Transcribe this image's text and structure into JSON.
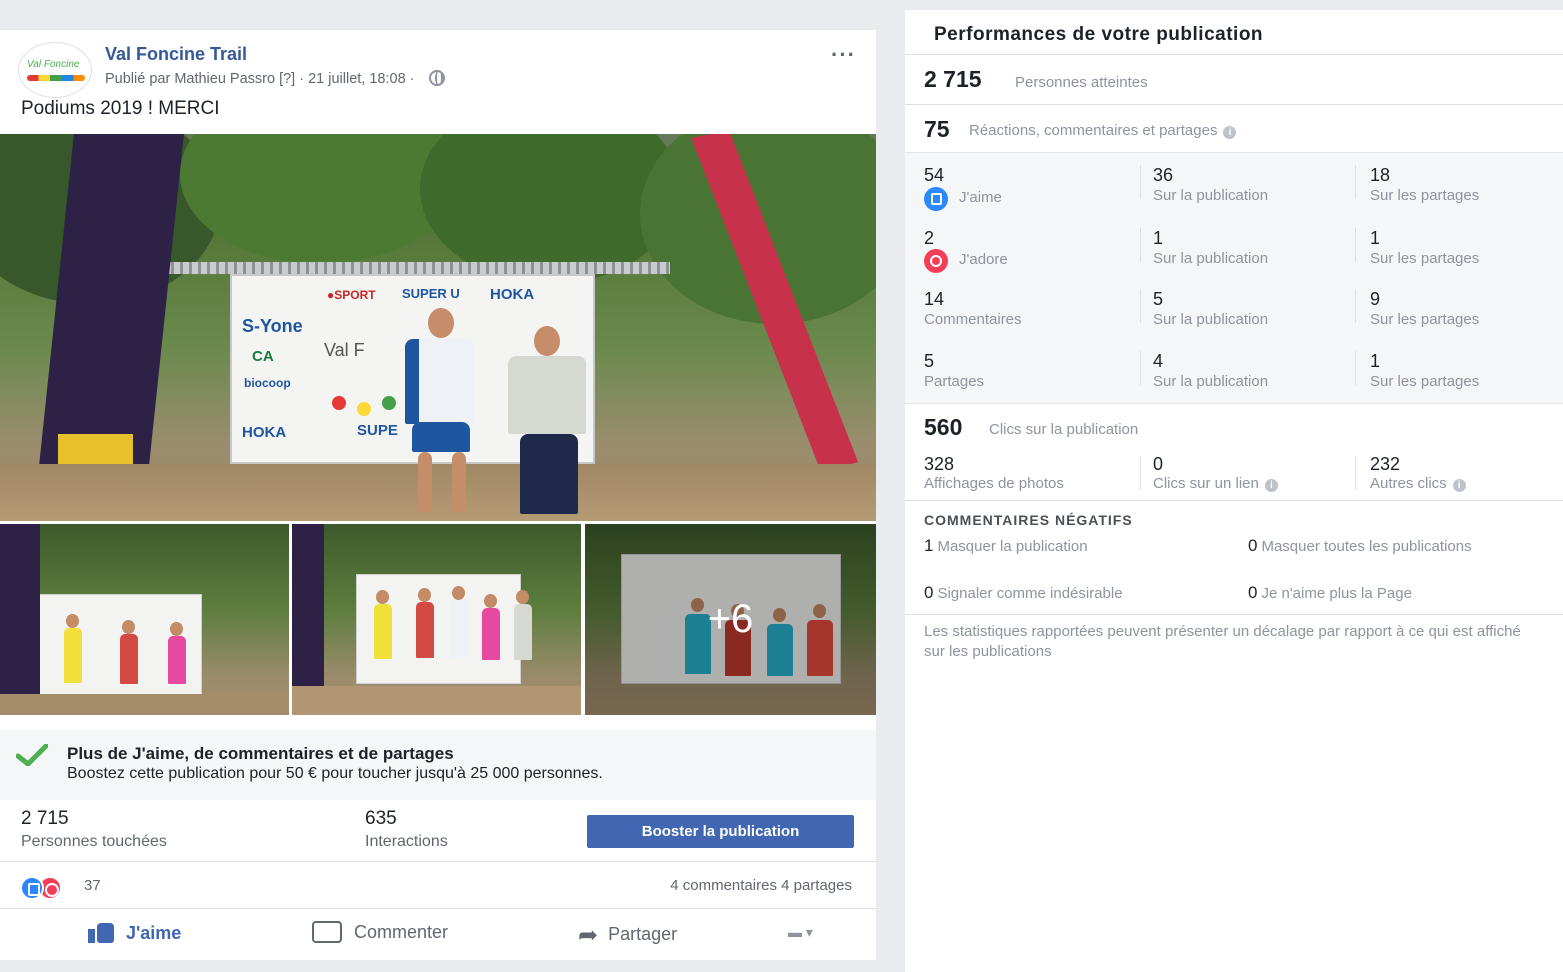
{
  "post": {
    "page_name": "Val Foncine Trail",
    "meta": "Publié par Mathieu Passro [?] · 21 juillet, 18:08 ·",
    "text": "Podiums 2019 ! MERCI",
    "more_photos": "+6",
    "boost_title": "Plus de J'aime, de commentaires et de partages",
    "boost_desc": "Boostez cette publication pour 50 € pour toucher jusqu'à 25 000 personnes.",
    "reach_value": "2 715",
    "reach_label": "Personnes touchées",
    "interactions_value": "635",
    "interactions_label": "Interactions",
    "boost_button": "Booster la publication",
    "reactions_count": "37",
    "comments_shares": "4 commentaires   4 partages",
    "actions": {
      "like": "J'aime",
      "comment": "Commenter",
      "share": "Partager"
    }
  },
  "insights": {
    "title": "Performances de votre publication",
    "reach": {
      "value": "2 715",
      "label": "Personnes atteintes"
    },
    "engagement": {
      "value": "75",
      "label": "Réactions, commentaires et partages"
    },
    "rows": [
      {
        "total": "54",
        "label": "J'aime",
        "on_post": "36",
        "on_post_label": "Sur la publication",
        "on_shares": "18",
        "on_shares_label": "Sur les partages"
      },
      {
        "total": "2",
        "label": "J'adore",
        "on_post": "1",
        "on_post_label": "Sur la publication",
        "on_shares": "1",
        "on_shares_label": "Sur les partages"
      },
      {
        "total": "14",
        "label": "Commentaires",
        "on_post": "5",
        "on_post_label": "Sur la publication",
        "on_shares": "9",
        "on_shares_label": "Sur les partages"
      },
      {
        "total": "5",
        "label": "Partages",
        "on_post": "4",
        "on_post_label": "Sur la publication",
        "on_shares": "1",
        "on_shares_label": "Sur les partages"
      }
    ],
    "clicks": {
      "value": "560",
      "label": "Clics sur la publication"
    },
    "click_breakdown": [
      {
        "value": "328",
        "label": "Affichages de photos"
      },
      {
        "value": "0",
        "label": "Clics sur un lien"
      },
      {
        "value": "232",
        "label": "Autres clics"
      }
    ],
    "negative_title": "COMMENTAIRES NÉGATIFS",
    "negative": [
      {
        "value": "1",
        "label": "Masquer la publication"
      },
      {
        "value": "0",
        "label": "Masquer toutes les publications"
      },
      {
        "value": "0",
        "label": "Signaler comme indésirable"
      },
      {
        "value": "0",
        "label": "Je n'aime plus la Page"
      }
    ],
    "footnote": "Les statistiques rapportées peuvent présenter un décalage par rapport à ce qui est affiché sur les publications"
  },
  "colors": {
    "brand": "#4267b2",
    "link": "#365899",
    "like": "#2d88ff",
    "love": "#f33e58",
    "check": "#4caf50"
  }
}
